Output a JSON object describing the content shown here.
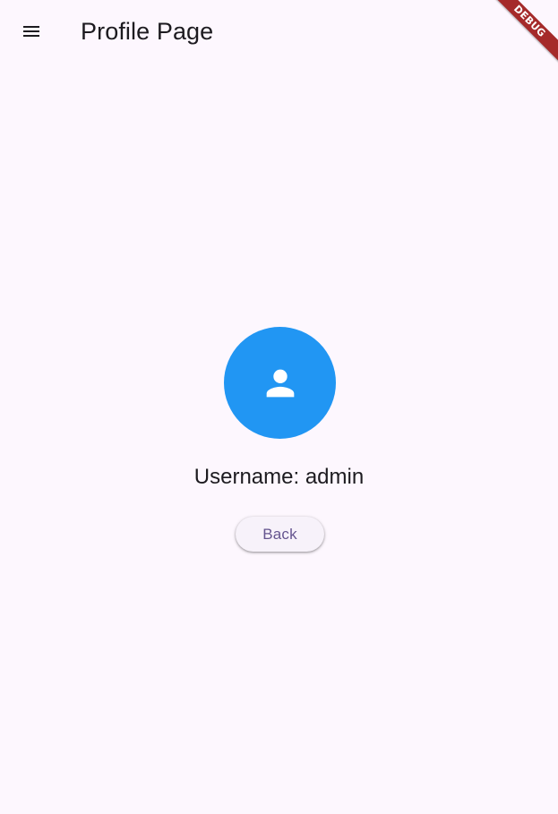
{
  "app_bar": {
    "title": "Profile Page",
    "menu_icon": "menu-icon"
  },
  "debug_banner": {
    "label": "DEBUG"
  },
  "profile": {
    "avatar_icon": "person-icon",
    "avatar_color": "#2196f3",
    "username_text": "Username: admin",
    "back_label": "Back"
  },
  "colors": {
    "background": "#fdf7fe",
    "text": "#1d1b20",
    "button_text": "#65558f",
    "button_background": "#f7f2fa",
    "debug_ribbon": "#a52a2a"
  }
}
